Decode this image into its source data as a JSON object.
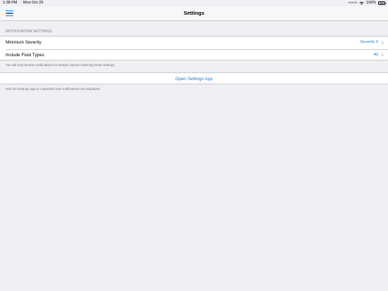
{
  "status_bar": {
    "time": "1:38 PM",
    "date": "Mon Oct 29",
    "battery_text": "100%",
    "icons": [
      "signal-dots-icon",
      "wifi-icon",
      "battery-icon"
    ]
  },
  "nav": {
    "title": "Settings",
    "menu_icon": "hamburger-menu-icon"
  },
  "notification_section": {
    "header": "NOTIFICATION SETTINGS",
    "rows": [
      {
        "label": "Minimum Severity",
        "value": "Severity 0"
      },
      {
        "label": "Include Fluid Types",
        "value": "All"
      }
    ],
    "footer": "You will only receive notifications for sample reports matching these settings."
  },
  "open_settings": {
    "label": "Open Settings App",
    "footer": "Use the Settings app to customize how notifications are displayed."
  },
  "colors": {
    "accent": "#1b7bd6",
    "background": "#efeff4",
    "secondary_text": "#6d6d72"
  }
}
